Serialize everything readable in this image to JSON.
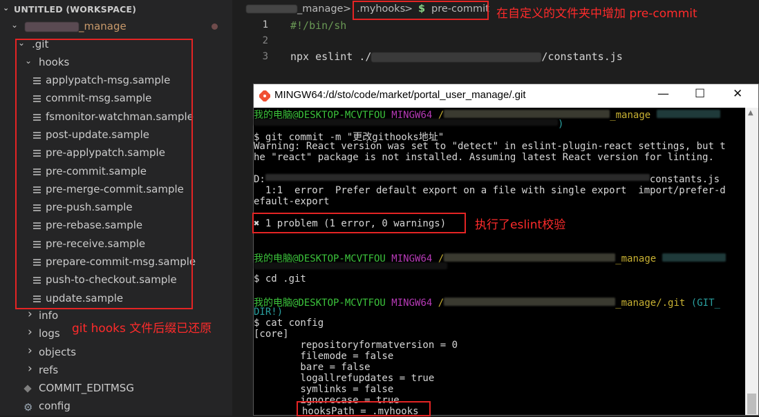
{
  "sidebar": {
    "workspace_title": "UNTITLED (WORKSPACE)",
    "project_suffix": "_manage",
    "git_folder": ".git",
    "hooks_folder": "hooks",
    "hook_files": [
      "applypatch-msg.sample",
      "commit-msg.sample",
      "fsmonitor-watchman.sample",
      "post-update.sample",
      "pre-applypatch.sample",
      "pre-commit.sample",
      "pre-merge-commit.sample",
      "pre-push.sample",
      "pre-rebase.sample",
      "pre-receive.sample",
      "prepare-commit-msg.sample",
      "push-to-checkout.sample",
      "update.sample"
    ],
    "folders": [
      "info",
      "logs",
      "objects",
      "refs"
    ],
    "files": [
      "COMMIT_EDITMSG",
      "config"
    ],
    "note": "git hooks 文件后缀已还原"
  },
  "editor": {
    "breadcrumb": {
      "project_suffix": "_manage",
      "sep": ">",
      "folder": ".myhooks",
      "file_icon": "$",
      "file": "pre-commit"
    },
    "note": "在自定义的文件夹中增加 pre-commit",
    "line_numbers": [
      "1",
      "2",
      "3"
    ],
    "lines": {
      "shebang": "#!/bin/sh",
      "cmd_prefix": "npx eslint ./",
      "cmd_suffix": "/constants.js"
    }
  },
  "terminal": {
    "title": "MINGW64:/d/sto/code/market/portal_user_manage/.git",
    "controls": {
      "minimize": "—",
      "maximize": "☐",
      "close": "✕"
    },
    "prompt_user": "我的电脑@DESKTOP-MCVTFOU",
    "prompt_env": "MINGW64",
    "prompt_slash": "/",
    "path_suffix_1": "_manage",
    "path_suffix_2": "_manage",
    "path_suffix_3": "_manage/.git",
    "branch_3": "(GIT_",
    "branch_3b": "DIR!)",
    "paren_close": ")",
    "cmd_commit": "$ git commit -m \"更改githooks地址\"",
    "warn_1": "Warning: React version was set to \"detect\" in eslint-plugin-react settings, but t",
    "warn_2": "he \"react\" package is not installed. Assuming latest React version for linting.",
    "d_prefix": "D:",
    "d_suffix": "constants.js",
    "err_1": "  1:1  error  Prefer default export on a file with single export  import/prefer-d",
    "err_2": "efault-export",
    "problem": "✖ 1 problem (1 error, 0 warnings)",
    "eslint_note": "执行了eslint校验",
    "cmd_cd": "$ cd .git",
    "cmd_cat": "$ cat config",
    "core": "[core]",
    "config_lines": [
      "        repositoryformatversion = 0",
      "        filemode = false",
      "        bare = false",
      "        logallrefupdates = true",
      "        symlinks = false",
      "        ignorecase = true"
    ],
    "hooks_path": "hooksPath = .myhooks"
  },
  "colors": {
    "annotation_red": "#e52424",
    "prompt_green": "#3cc43c",
    "prompt_magenta": "#b73ab7",
    "path_yellow": "#c9b233",
    "branch_cyan": "#2aa0a0"
  }
}
